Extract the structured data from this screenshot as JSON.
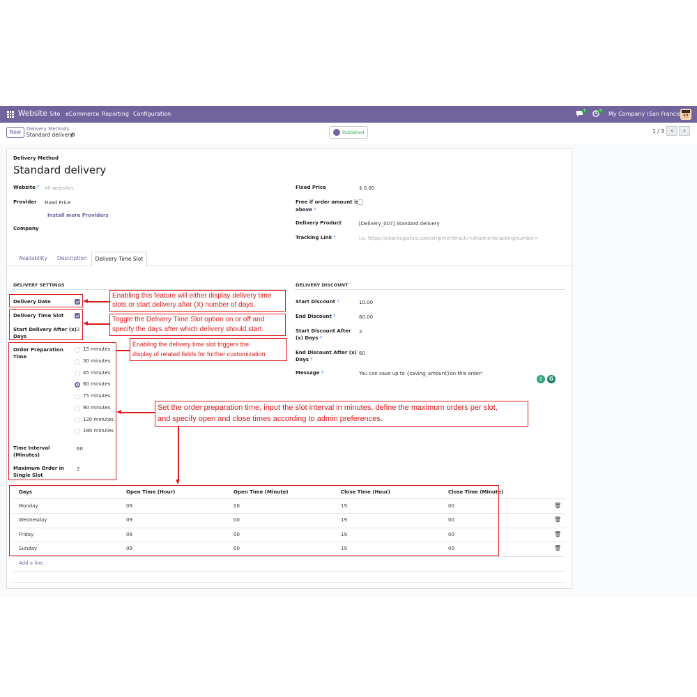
{
  "navbar": {
    "app_name": "Website",
    "menu": [
      "Site",
      "eCommerce",
      "Reporting",
      "Configuration"
    ],
    "messages_badge": "7",
    "activity_badge": "5",
    "company": "My Company (San Francisco)"
  },
  "control": {
    "new_label": "New",
    "breadcrumb_parent": "Delivery Methods",
    "breadcrumb_current": "Standard delivery",
    "published_label": "Published",
    "pager": "1 / 3"
  },
  "form": {
    "heading_label": "Delivery Method",
    "name": "Standard delivery",
    "website_label": "Website",
    "website_placeholder": "All websites",
    "provider_label": "Provider",
    "provider_value": "Fixed Price",
    "install_link": "Install more Providers",
    "company_label": "Company",
    "fixed_price_label": "Fixed Price",
    "fixed_price_value": "$ 0.00",
    "free_if_label_1": "Free if order amount is",
    "free_if_label_2": "above",
    "delivery_product_label": "Delivery Product",
    "delivery_product_value": "[Delivery_007] Standard delivery",
    "tracking_link_label": "Tracking Link",
    "tracking_link_placeholder": "i.e. https://ekartlogistics.com/shipmenttrack/<shipmenttrackingnumber>"
  },
  "tabs": [
    "Availability",
    "Description",
    "Delivery Time Slot"
  ],
  "settings": {
    "section_title": "DELIVERY SETTINGS",
    "delivery_date_label": "Delivery Date",
    "delivery_time_slot_label": "Delivery Time Slot",
    "start_after_label_1": "Start Delivery After (x)",
    "start_after_label_2": "Days",
    "start_after_value": "2",
    "prep_time_label_1": "Order Preparation",
    "prep_time_label_2": "Time",
    "prep_options": [
      "15 minutes",
      "30 minutes",
      "45 minutes",
      "60 minutes",
      "75 minutes",
      "90 minutes",
      "120 minutes",
      "180 minutes"
    ],
    "prep_selected": "60 minutes",
    "time_interval_label_1": "Time Interval",
    "time_interval_label_2": "(Minutes)",
    "time_interval_value": "60",
    "max_order_label_1": "Maximum Order in",
    "max_order_label_2": "Single Slot",
    "max_order_value": "2"
  },
  "discount": {
    "section_title": "DELIVERY DISCOUNT",
    "start_discount_label": "Start Discount",
    "start_discount_value": "10.00",
    "end_discount_label": "End Discount",
    "end_discount_value": "60.00",
    "start_after_label_1": "Start Discount After",
    "start_after_label_2": "(x) Days",
    "start_after_value": "2",
    "end_after_label_1": "End Discount After (x)",
    "end_after_label_2": "Days",
    "end_after_value": "60",
    "message_label": "Message",
    "message_value": "You can save up to {saving_amount}on this order!"
  },
  "table": {
    "headers": [
      "Days",
      "Open Time (Hour)",
      "Open Time (Minute)",
      "Close Time (Hour)",
      "Close Time (Minute)"
    ],
    "rows": [
      [
        "Monday",
        "09",
        "00",
        "19",
        "00"
      ],
      [
        "Wednesday",
        "09",
        "00",
        "19",
        "00"
      ],
      [
        "Friday",
        "09",
        "00",
        "19",
        "00"
      ],
      [
        "Sunday",
        "09",
        "00",
        "19",
        "00"
      ]
    ],
    "add_line": "Add a line"
  },
  "annotations": {
    "note1_line1": "Enabling this feature will either display delivery time",
    "note1_line2": "slots or start delivery after (X) number of days.",
    "note2_line1": "Toggle the Delivery Time Slot option on or off and",
    "note2_line2": "specify the days after which delivery should start.",
    "note3_line1": "Enabling the delivery time slot triggers the",
    "note3_line2": "display of related fields for further customization.",
    "note4_line1": "Set the order preparation time, input the slot interval in minutes, define the maximum orders per slot,",
    "note4_line2": "and specify open and close times according to admin preferences."
  },
  "colors": {
    "brand": "#71639e",
    "annotation": "#e01919",
    "published": "#28a745"
  }
}
